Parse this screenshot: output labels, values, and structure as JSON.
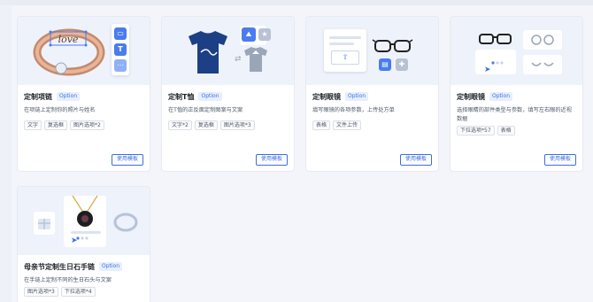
{
  "colors": {
    "accent": "#3b6fe0",
    "badge_bg": "#e6efff",
    "thumb_bg": "#eef2fa"
  },
  "cards": [
    {
      "title": "定制项链",
      "badge": "Option",
      "desc": "在项链上定制你的照片与姓名",
      "tags": [
        "文字",
        "复选框",
        "图片选项*2"
      ],
      "button": "使用模板",
      "thumb_text": "love"
    },
    {
      "title": "定制T恤",
      "badge": "Option",
      "desc": "在T恤的正反面定制图案与文案",
      "tags": [
        "文字*2",
        "复选框",
        "图片选项*3"
      ],
      "button": "使用模板"
    },
    {
      "title": "定制眼镜",
      "badge": "Option",
      "desc": "填写眼镜的各项参数，上传处方单",
      "tags": [
        "表格",
        "文件上传"
      ],
      "button": "使用模板"
    },
    {
      "title": "定制眼镜",
      "badge": "Option",
      "desc": "选择眼睛的部件类型与参数，填写左右眼的近视数据",
      "tags": [
        "下拉选项*57",
        "表格"
      ],
      "button": "使用模板"
    },
    {
      "title": "母亲节定制生日石手链",
      "badge": "Option",
      "desc": "在手链上定制不同的生日石头与文案",
      "tags": [
        "图片选项*3",
        "下拉选项*4"
      ],
      "button": "使用模板"
    }
  ]
}
